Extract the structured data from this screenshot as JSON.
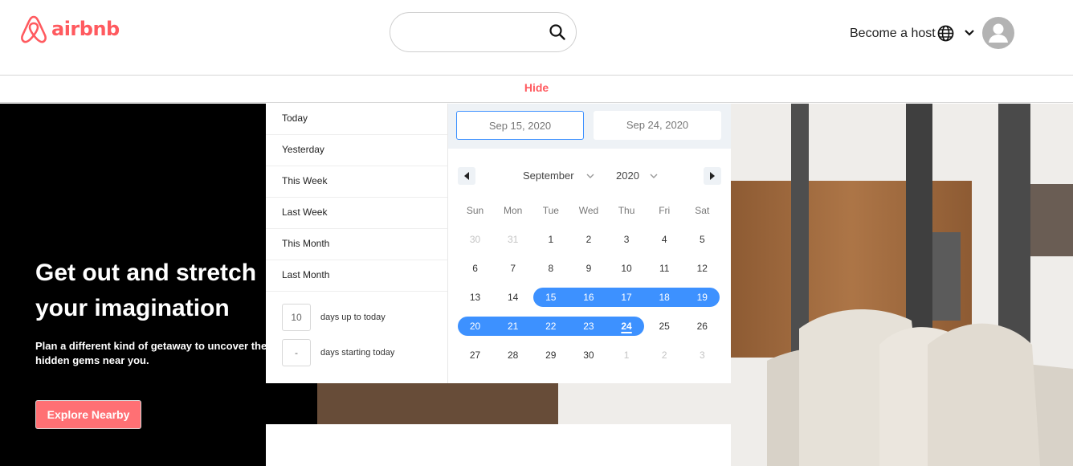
{
  "header": {
    "logo_text": "airbnb",
    "search": {
      "value": "",
      "placeholder": ""
    },
    "host_link": "Become a host",
    "hide_label": "Hide"
  },
  "hero": {
    "title": "Get out and stretch your imagination",
    "subtitle": "Plan a different kind of getaway to uncover the hidden gems near you.",
    "cta": "Explore Nearby"
  },
  "picker": {
    "ranges": [
      "Today",
      "Yesterday",
      "This Week",
      "Last Week",
      "This Month",
      "Last Month"
    ],
    "days_up": {
      "value": "10",
      "label": "days up to today"
    },
    "days_start": {
      "value": "-",
      "label": "days starting today"
    },
    "start_date": "Sep 15, 2020",
    "end_date": "Sep 24, 2020",
    "month": "September",
    "year": "2020",
    "weekdays": [
      "Sun",
      "Mon",
      "Tue",
      "Wed",
      "Thu",
      "Fri",
      "Sat"
    ],
    "weeks": [
      [
        "30",
        "31",
        "1",
        "2",
        "3",
        "4",
        "5"
      ],
      [
        "6",
        "7",
        "8",
        "9",
        "10",
        "11",
        "12"
      ],
      [
        "13",
        "14",
        "15",
        "16",
        "17",
        "18",
        "19"
      ],
      [
        "20",
        "21",
        "22",
        "23",
        "24",
        "25",
        "26"
      ],
      [
        "27",
        "28",
        "29",
        "30",
        "1",
        "2",
        "3"
      ]
    ],
    "muted_days": [
      [
        0,
        0
      ],
      [
        0,
        1
      ],
      [
        4,
        4
      ],
      [
        4,
        5
      ],
      [
        4,
        6
      ]
    ],
    "selected_start": "15",
    "selected_end": "24",
    "today": "24"
  },
  "colors": {
    "brand": "#ff5a5f",
    "accent": "#3d91ff"
  }
}
